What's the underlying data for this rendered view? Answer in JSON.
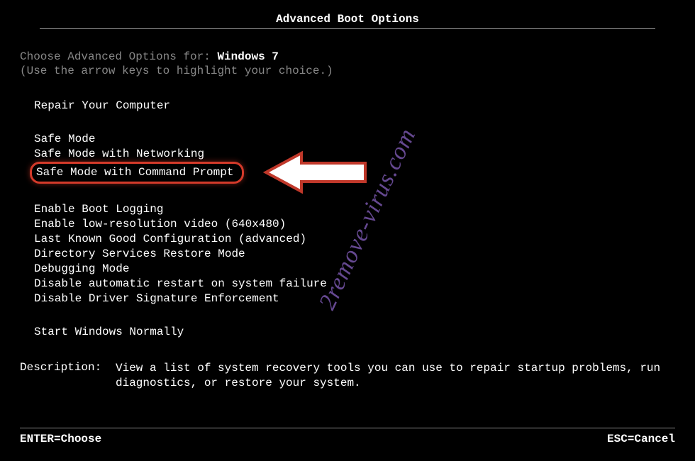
{
  "title": "Advanced Boot Options",
  "choose_prefix": "Choose Advanced Options for: ",
  "os_name": "Windows 7",
  "hint": "(Use the arrow keys to highlight your choice.)",
  "group1": {
    "items": [
      "Repair Your Computer"
    ]
  },
  "group2": {
    "items": [
      "Safe Mode",
      "Safe Mode with Networking",
      "Safe Mode with Command Prompt"
    ]
  },
  "group3": {
    "items": [
      "Enable Boot Logging",
      "Enable low-resolution video (640x480)",
      "Last Known Good Configuration (advanced)",
      "Directory Services Restore Mode",
      "Debugging Mode",
      "Disable automatic restart on system failure",
      "Disable Driver Signature Enforcement"
    ]
  },
  "group4": {
    "items": [
      "Start Windows Normally"
    ]
  },
  "desc_label": "Description:",
  "desc_text": "View a list of system recovery tools you can use to repair startup problems, run diagnostics, or restore your system.",
  "footer": {
    "enter": "ENTER=Choose",
    "esc": "ESC=Cancel"
  },
  "watermark": "2remove-virus.com"
}
